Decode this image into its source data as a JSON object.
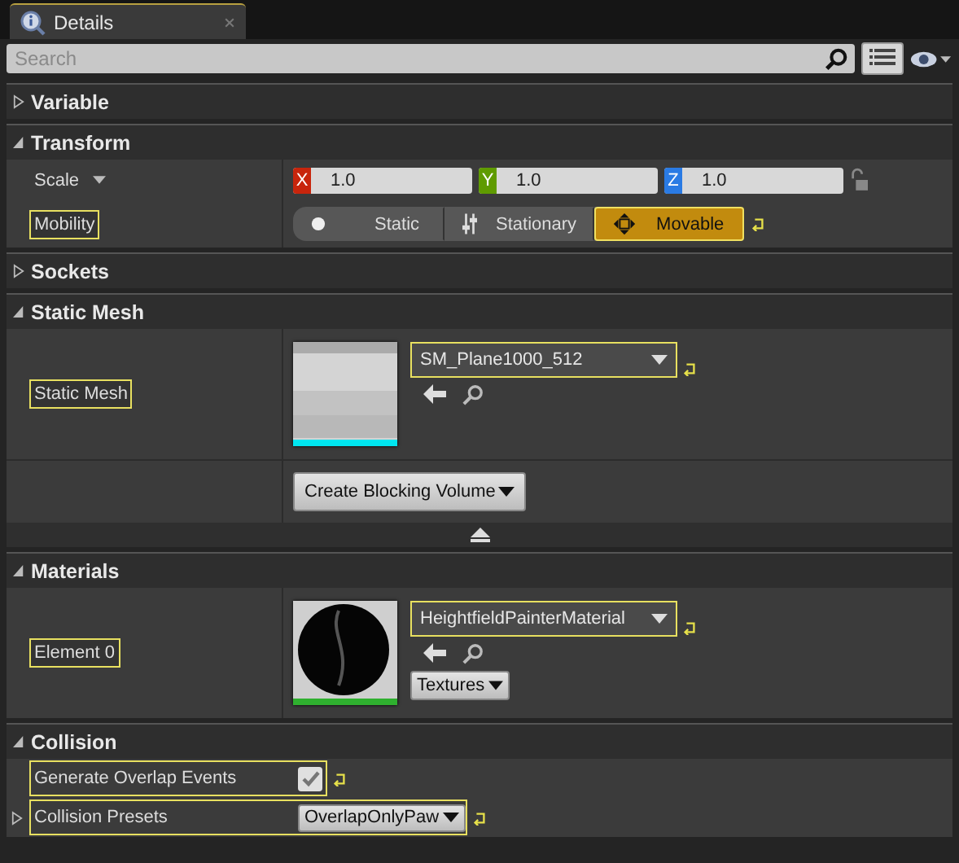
{
  "tab": {
    "title": "Details"
  },
  "search": {
    "placeholder": "Search"
  },
  "categories": [
    {
      "title": "Variable",
      "expanded": false
    },
    {
      "title": "Transform",
      "expanded": true,
      "rows": [
        {
          "kind": "vector",
          "label": "Scale",
          "highlighted": false,
          "components": [
            {
              "axis": "X",
              "value": "1.0",
              "color": "#c8250c"
            },
            {
              "axis": "Y",
              "value": "1.0",
              "color": "#5f9b00"
            },
            {
              "axis": "Z",
              "value": "1.0",
              "color": "#2a7be4"
            }
          ]
        },
        {
          "kind": "toggle",
          "label": "Mobility",
          "highlighted": true,
          "reset": true,
          "options": [
            {
              "label": "Static",
              "selected": false
            },
            {
              "label": "Stationary",
              "selected": false
            },
            {
              "label": "Movable",
              "selected": true
            }
          ]
        }
      ]
    },
    {
      "title": "Sockets",
      "expanded": false
    },
    {
      "title": "Static Mesh",
      "expanded": true,
      "advanced_expanded": true,
      "rows": [
        {
          "kind": "asset",
          "label": "Static Mesh",
          "highlighted": true,
          "reset": true,
          "value": "SM_Plane1000_512",
          "thumbnail": {
            "kind": "mesh"
          }
        },
        {
          "kind": "button",
          "button": "Create Blocking Volume"
        }
      ]
    },
    {
      "title": "Materials",
      "expanded": true,
      "rows": [
        {
          "kind": "asset",
          "label": "Element 0",
          "highlighted": true,
          "reset": true,
          "value": "HeightfieldPainterMaterial",
          "thumbnail": {
            "kind": "material"
          },
          "extra_button": "Textures"
        }
      ]
    },
    {
      "title": "Collision",
      "expanded": true,
      "rows": [
        {
          "kind": "checkbox",
          "label": "Generate Overlap Events",
          "highlighted": true,
          "reset": true,
          "checked": true
        },
        {
          "kind": "combo",
          "label": "Collision Presets",
          "highlighted": true,
          "reset": true,
          "value": "OverlapOnlyPaw",
          "expanded": false
        }
      ]
    }
  ]
}
